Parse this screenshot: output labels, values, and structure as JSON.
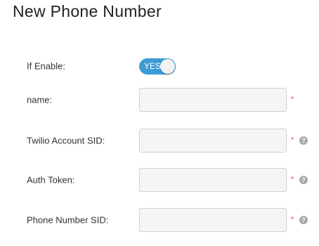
{
  "page": {
    "title": "New Phone Number"
  },
  "form": {
    "enable": {
      "label": "If Enable:",
      "toggle_text": "YES",
      "on": true
    },
    "fields": [
      {
        "label": "name:",
        "value": "",
        "required_mark": "*",
        "help_icon": false
      },
      {
        "label": "Twilio Account SID:",
        "value": "",
        "required_mark": "*",
        "help_icon": "question-icon"
      },
      {
        "label": "Auth Token:",
        "value": "",
        "required_mark": "*",
        "help_icon": "question-icon"
      },
      {
        "label": "Phone Number SID:",
        "value": "",
        "required_mark": "*",
        "help_icon": "question-icon"
      }
    ],
    "help_glyph": "?"
  },
  "colors": {
    "toggle_on": "#3a9bd5",
    "required": "#e24a3b",
    "help_icon": "#a9a9a9",
    "field_background": "#f5f5f5"
  }
}
